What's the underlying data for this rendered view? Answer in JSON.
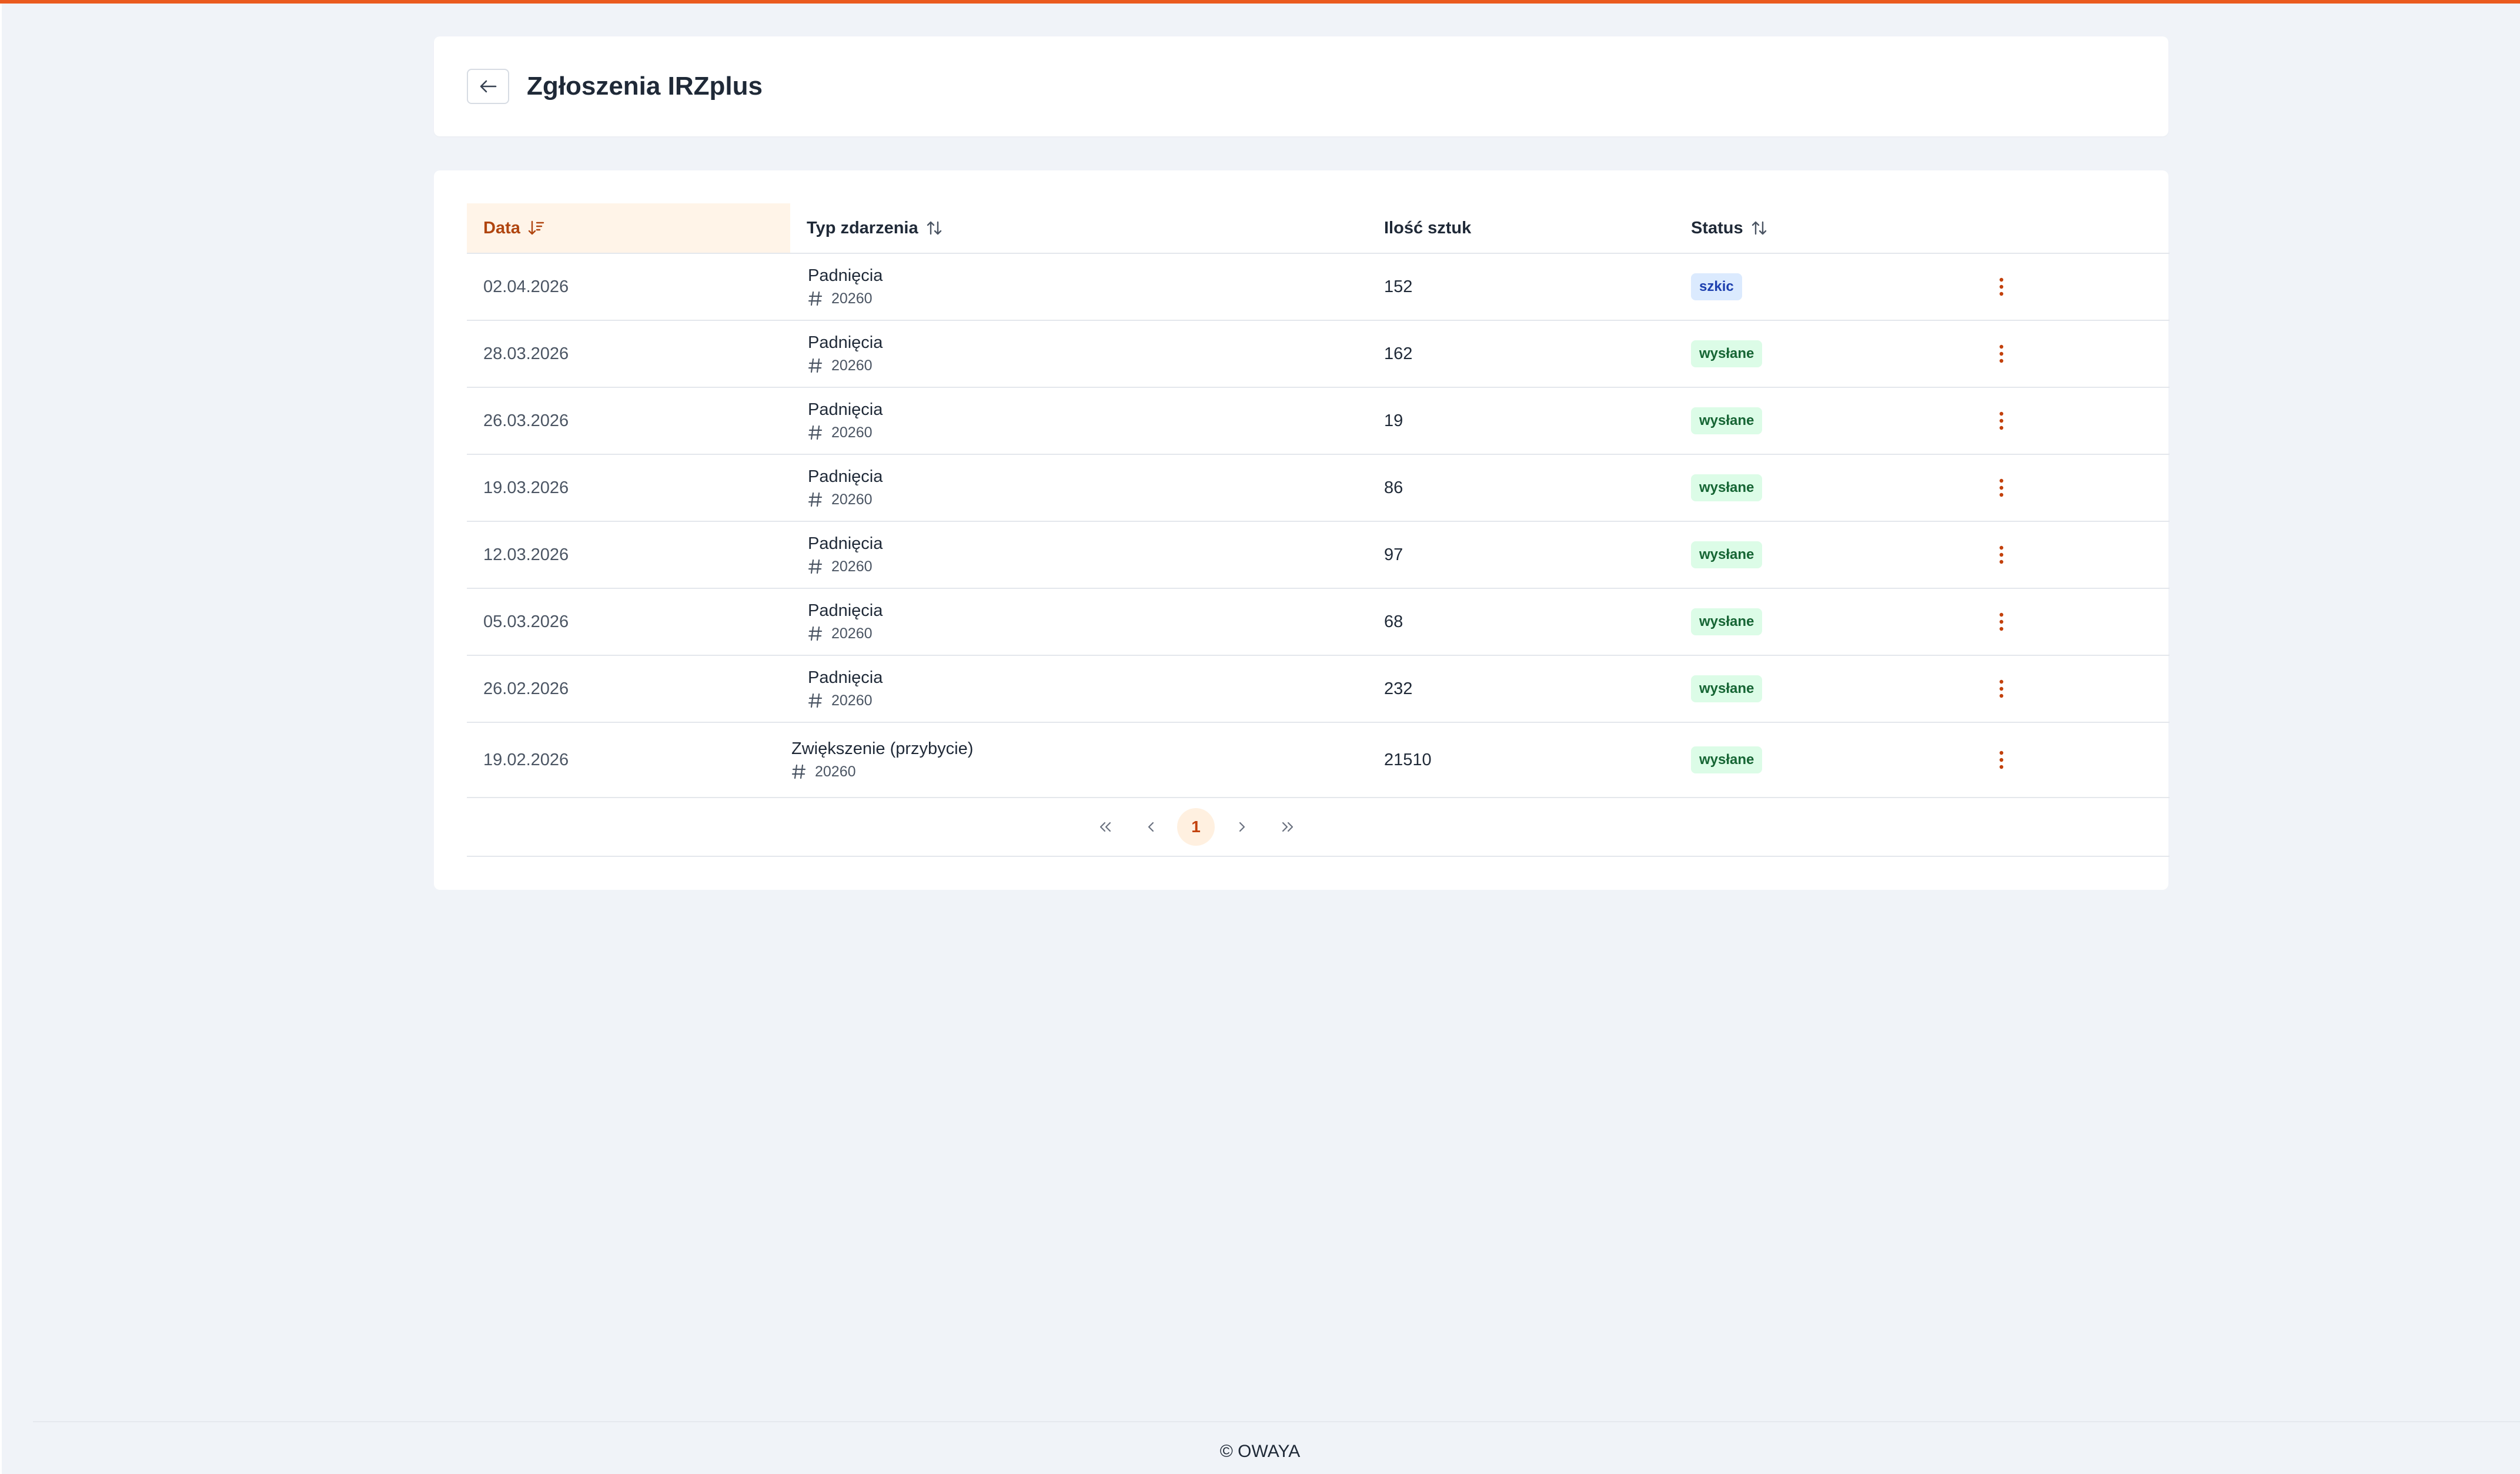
{
  "header": {
    "title": "Zgłoszenia IRZplus",
    "back_icon": "arrow-left-icon"
  },
  "table": {
    "columns": {
      "date": "Data",
      "type": "Typ zdarzenia",
      "qty": "Ilość sztuk",
      "status": "Status"
    },
    "sort": {
      "active_column": "date",
      "direction": "descending"
    },
    "rows": [
      {
        "date": "02.04.2026",
        "type": "Padnięcia",
        "id": "20260",
        "qty": "152",
        "status": "szkic",
        "status_kind": "draft"
      },
      {
        "date": "28.03.2026",
        "type": "Padnięcia",
        "id": "20260",
        "qty": "162",
        "status": "wysłane",
        "status_kind": "sent"
      },
      {
        "date": "26.03.2026",
        "type": "Padnięcia",
        "id": "20260",
        "qty": "19",
        "status": "wysłane",
        "status_kind": "sent"
      },
      {
        "date": "19.03.2026",
        "type": "Padnięcia",
        "id": "20260",
        "qty": "86",
        "status": "wysłane",
        "status_kind": "sent"
      },
      {
        "date": "12.03.2026",
        "type": "Padnięcia",
        "id": "20260",
        "qty": "97",
        "status": "wysłane",
        "status_kind": "sent"
      },
      {
        "date": "05.03.2026",
        "type": "Padnięcia",
        "id": "20260",
        "qty": "68",
        "status": "wysłane",
        "status_kind": "sent"
      },
      {
        "date": "26.02.2026",
        "type": "Padnięcia",
        "id": "20260",
        "qty": "232",
        "status": "wysłane",
        "status_kind": "sent"
      },
      {
        "date": "19.02.2026",
        "type": "Zwiększenie (przybycie)",
        "id": "20260",
        "qty": "21510",
        "status": "wysłane",
        "status_kind": "sent"
      }
    ]
  },
  "pagination": {
    "current_page": "1",
    "first_label": "«",
    "prev_label": "‹",
    "next_label": "›",
    "last_label": "»"
  },
  "footer": {
    "copyright": "© OWAYA"
  },
  "colors": {
    "accent": "#ea5a1f",
    "draft_badge_bg": "#dbeafe",
    "sent_badge_bg": "#dcfce7",
    "kebab": "#c2410c"
  }
}
